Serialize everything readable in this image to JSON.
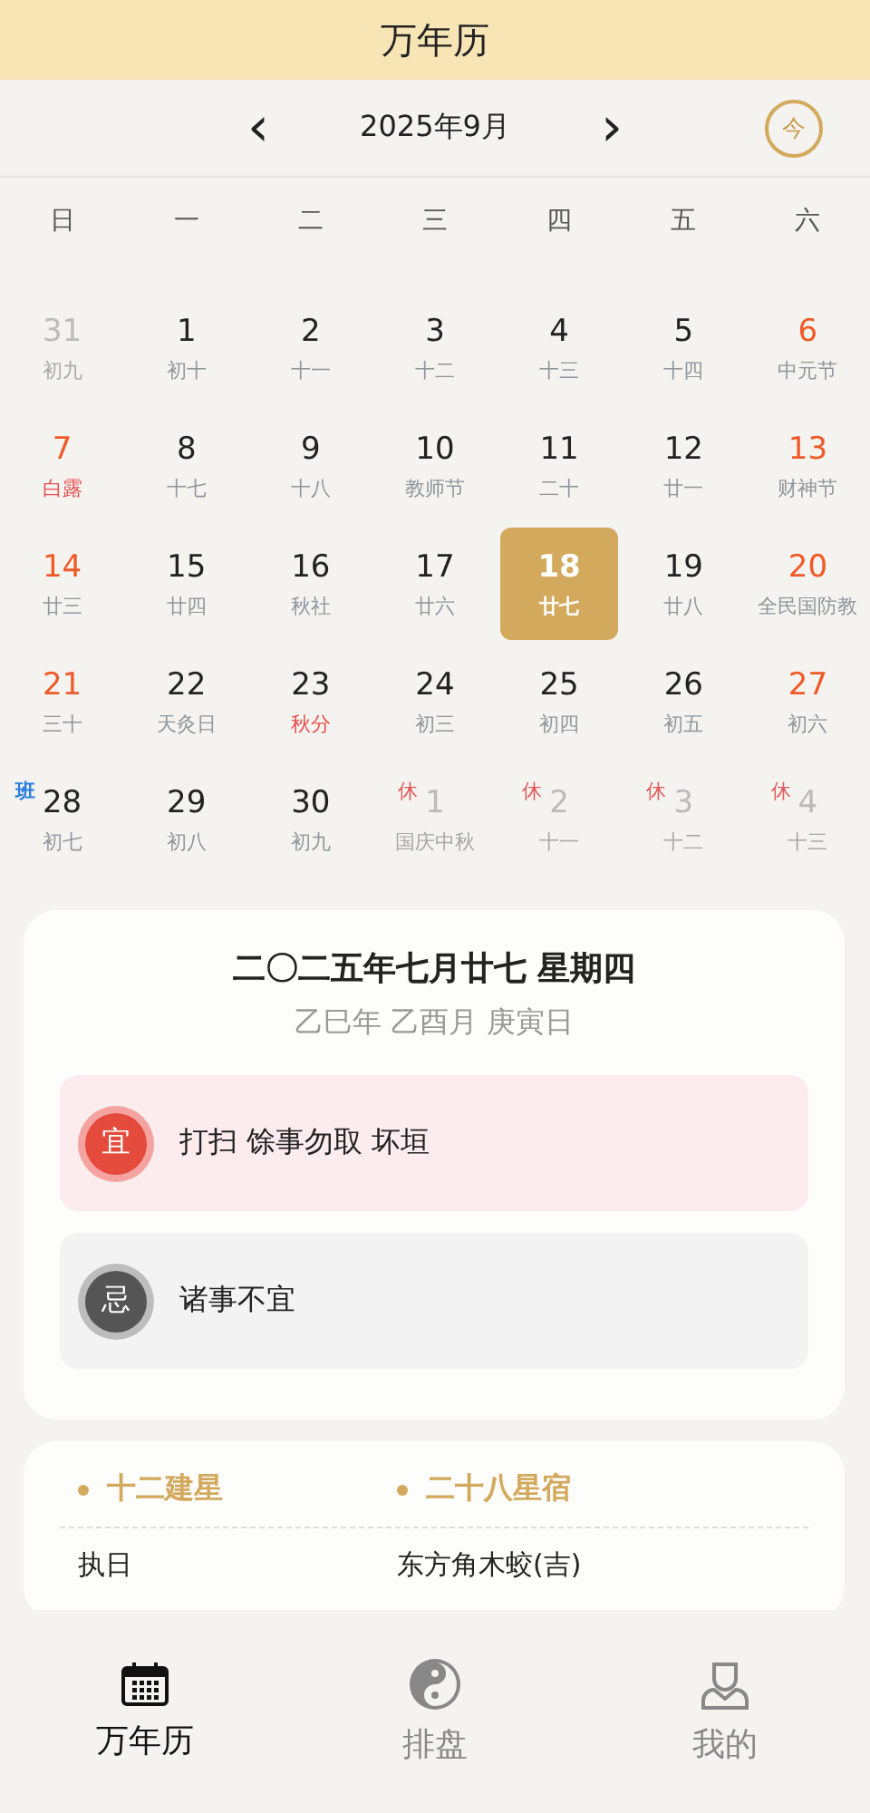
{
  "header": {
    "title": "万年历"
  },
  "nav": {
    "month": "2025年9月",
    "prev": "‹",
    "next": "›",
    "today": "今"
  },
  "weekdays": [
    "日",
    "一",
    "二",
    "三",
    "四",
    "五",
    "六"
  ],
  "days": [
    {
      "day": "31",
      "lunar": "初九",
      "muted": true,
      "red_day": false,
      "red_lunar": false,
      "selected": false
    },
    {
      "day": "1",
      "lunar": "初十",
      "muted": false,
      "red_day": false,
      "red_lunar": false,
      "selected": false
    },
    {
      "day": "2",
      "lunar": "十一",
      "muted": false,
      "red_day": false,
      "red_lunar": false,
      "selected": false
    },
    {
      "day": "3",
      "lunar": "十二",
      "muted": false,
      "red_day": false,
      "red_lunar": false,
      "selected": false
    },
    {
      "day": "4",
      "lunar": "十三",
      "muted": false,
      "red_day": false,
      "red_lunar": false,
      "selected": false
    },
    {
      "day": "5",
      "lunar": "十四",
      "muted": false,
      "red_day": false,
      "red_lunar": false,
      "selected": false
    },
    {
      "day": "6",
      "lunar": "中元节",
      "muted": false,
      "red_day": true,
      "red_lunar": false,
      "selected": false
    },
    {
      "day": "7",
      "lunar": "白露",
      "muted": false,
      "red_day": true,
      "red_lunar": true,
      "selected": false
    },
    {
      "day": "8",
      "lunar": "十七",
      "muted": false,
      "red_day": false,
      "red_lunar": false,
      "selected": false
    },
    {
      "day": "9",
      "lunar": "十八",
      "muted": false,
      "red_day": false,
      "red_lunar": false,
      "selected": false
    },
    {
      "day": "10",
      "lunar": "教师节",
      "muted": false,
      "red_day": false,
      "red_lunar": false,
      "selected": false
    },
    {
      "day": "11",
      "lunar": "二十",
      "muted": false,
      "red_day": false,
      "red_lunar": false,
      "selected": false
    },
    {
      "day": "12",
      "lunar": "廿一",
      "muted": false,
      "red_day": false,
      "red_lunar": false,
      "selected": false
    },
    {
      "day": "13",
      "lunar": "财神节",
      "muted": false,
      "red_day": true,
      "red_lunar": false,
      "selected": false
    },
    {
      "day": "14",
      "lunar": "廿三",
      "muted": false,
      "red_day": true,
      "red_lunar": false,
      "selected": false
    },
    {
      "day": "15",
      "lunar": "廿四",
      "muted": false,
      "red_day": false,
      "red_lunar": false,
      "selected": false
    },
    {
      "day": "16",
      "lunar": "秋社",
      "muted": false,
      "red_day": false,
      "red_lunar": false,
      "selected": false
    },
    {
      "day": "17",
      "lunar": "廿六",
      "muted": false,
      "red_day": false,
      "red_lunar": false,
      "selected": false
    },
    {
      "day": "18",
      "lunar": "廿七",
      "muted": false,
      "red_day": false,
      "red_lunar": false,
      "selected": true
    },
    {
      "day": "19",
      "lunar": "廿八",
      "muted": false,
      "red_day": false,
      "red_lunar": false,
      "selected": false
    },
    {
      "day": "20",
      "lunar": "全民国防教",
      "muted": false,
      "red_day": true,
      "red_lunar": false,
      "selected": false
    },
    {
      "day": "21",
      "lunar": "三十",
      "muted": false,
      "red_day": true,
      "red_lunar": false,
      "selected": false
    },
    {
      "day": "22",
      "lunar": "天灸日",
      "muted": false,
      "red_day": false,
      "red_lunar": false,
      "selected": false
    },
    {
      "day": "23",
      "lunar": "秋分",
      "muted": false,
      "red_day": false,
      "red_lunar": true,
      "selected": false
    },
    {
      "day": "24",
      "lunar": "初三",
      "muted": false,
      "red_day": false,
      "red_lunar": false,
      "selected": false
    },
    {
      "day": "25",
      "lunar": "初四",
      "muted": false,
      "red_day": false,
      "red_lunar": false,
      "selected": false
    },
    {
      "day": "26",
      "lunar": "初五",
      "muted": false,
      "red_day": false,
      "red_lunar": false,
      "selected": false
    },
    {
      "day": "27",
      "lunar": "初六",
      "muted": false,
      "red_day": true,
      "red_lunar": false,
      "selected": false
    },
    {
      "day": "28",
      "lunar": "初七",
      "muted": false,
      "red_day": false,
      "red_lunar": false,
      "selected": false,
      "badge": {
        "text": "班",
        "kind": "work"
      }
    },
    {
      "day": "29",
      "lunar": "初八",
      "muted": false,
      "red_day": false,
      "red_lunar": false,
      "selected": false
    },
    {
      "day": "30",
      "lunar": "初九",
      "muted": false,
      "red_day": false,
      "red_lunar": false,
      "selected": false
    },
    {
      "day": "1",
      "lunar": "国庆中秋",
      "muted": true,
      "red_day": false,
      "red_lunar": false,
      "selected": false,
      "badge": {
        "text": "休",
        "kind": "rest"
      }
    },
    {
      "day": "2",
      "lunar": "十一",
      "muted": true,
      "red_day": false,
      "red_lunar": false,
      "selected": false,
      "badge": {
        "text": "休",
        "kind": "rest"
      }
    },
    {
      "day": "3",
      "lunar": "十二",
      "muted": true,
      "red_day": false,
      "red_lunar": false,
      "selected": false,
      "badge": {
        "text": "休",
        "kind": "rest"
      }
    },
    {
      "day": "4",
      "lunar": "十三",
      "muted": true,
      "red_day": false,
      "red_lunar": false,
      "selected": false,
      "badge": {
        "text": "休",
        "kind": "rest"
      }
    }
  ],
  "detail": {
    "lunar_date": "二〇二五年七月廿七 星期四",
    "ganzhi": "乙巳年 乙酉月 庚寅日",
    "items": [
      {
        "kind": "good",
        "mark": "宜",
        "text": "打扫 馀事勿取 坏垣"
      },
      {
        "kind": "bad",
        "mark": "忌",
        "text": "诸事不宜"
      }
    ]
  },
  "stars": {
    "columns": [
      {
        "heading": "十二建星",
        "value": "执日"
      },
      {
        "heading": "二十八星宿",
        "value": "东方角木蛟(吉)"
      }
    ]
  },
  "tab_bar": [
    {
      "label": "万年历",
      "selected": true
    },
    {
      "label": "排盘",
      "selected": false
    },
    {
      "label": "我的",
      "selected": false
    }
  ]
}
